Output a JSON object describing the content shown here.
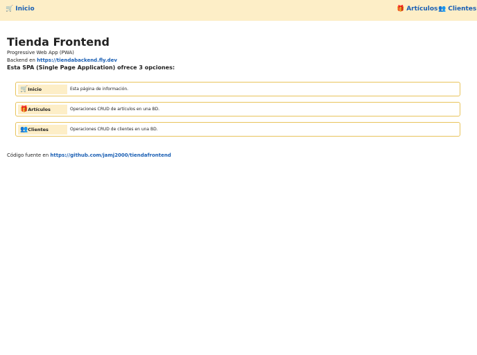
{
  "nav": {
    "inicio": {
      "icon": "🛒",
      "label": "Inicio"
    },
    "articulos": {
      "icon": "🎁",
      "label": "Artículos"
    },
    "clientes": {
      "icon": "👥",
      "label": "Clientes"
    }
  },
  "main": {
    "title": "Tienda Frontend",
    "subtitle": "Progressive Web App (PWA)",
    "backend_prefix": "Backend en ",
    "backend_link": "https://tiendabackend.fly.dev",
    "intro": "Esta SPA (Single Page Application) ofrece 3 opciones:",
    "options": [
      {
        "icon": "🛒",
        "label": "Inicio",
        "description": "Esta página de información."
      },
      {
        "icon": "🎁",
        "label": "Artículos",
        "description": "Operaciones CRUD de artículos en una BD."
      },
      {
        "icon": "👥",
        "label": "Clientes",
        "description": "Operaciones CRUD de clientes en una BD."
      }
    ],
    "source_prefix": "Código fuente en ",
    "source_link": "https://github.com/jamj2000/tiendafrontend"
  },
  "colors": {
    "topbar_bg": "#fdeec7",
    "link": "#1a5fb4",
    "option_border": "#e8c35a"
  }
}
